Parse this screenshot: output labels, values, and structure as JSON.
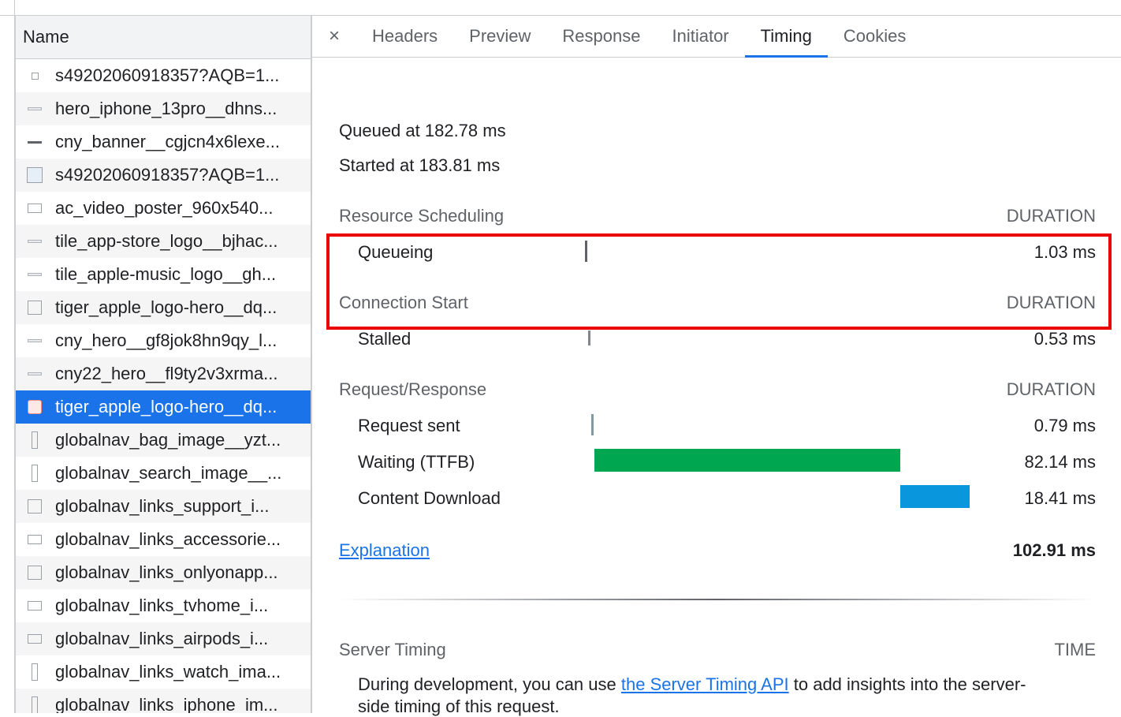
{
  "network_list": {
    "header": "Name",
    "rows": [
      {
        "name": "s49202060918357?AQB=1...",
        "icon": "small-square-icon"
      },
      {
        "name": "hero_iphone_13pro__dhns...",
        "icon": "dash-icon"
      },
      {
        "name": "cny_banner__cgjcn4x6lexe...",
        "icon": "dark-dash-icon"
      },
      {
        "name": "s49202060918357?AQB=1...",
        "icon": "image-icon"
      },
      {
        "name": "ac_video_poster_960x540...",
        "icon": "rect-icon"
      },
      {
        "name": "tile_app-store_logo__bjhac...",
        "icon": "dash-icon"
      },
      {
        "name": "tile_apple-music_logo__gh...",
        "icon": "dash-icon"
      },
      {
        "name": "tiger_apple_logo-hero__dq...",
        "icon": "square-icon"
      },
      {
        "name": "cny_hero__gf8jok8hn9qy_l...",
        "icon": "dash-icon"
      },
      {
        "name": "cny22_hero__fl9ty2v3xrma...",
        "icon": "dash-icon"
      },
      {
        "name": "tiger_apple_logo-hero__dq...",
        "icon": "apple-image-icon",
        "selected": true
      },
      {
        "name": "globalnav_bag_image__yzt...",
        "icon": "tall-rect-icon"
      },
      {
        "name": "globalnav_search_image__...",
        "icon": "tall-rect-icon"
      },
      {
        "name": "globalnav_links_support_i...",
        "icon": "square-icon"
      },
      {
        "name": "globalnav_links_accessorie...",
        "icon": "rect-icon"
      },
      {
        "name": "globalnav_links_onlyonapp...",
        "icon": "square-icon"
      },
      {
        "name": "globalnav_links_tvhome_i...",
        "icon": "rect-icon"
      },
      {
        "name": "globalnav_links_airpods_i...",
        "icon": "rect-icon"
      },
      {
        "name": "globalnav_links_watch_ima...",
        "icon": "tall-rect-icon"
      },
      {
        "name": "globalnav_links_iphone_im...",
        "icon": "tall-rect-icon"
      }
    ]
  },
  "tabs": {
    "close_glyph": "×",
    "items": [
      "Headers",
      "Preview",
      "Response",
      "Initiator",
      "Timing",
      "Cookies"
    ],
    "active": "Timing"
  },
  "timing": {
    "queued_at": "Queued at 182.78 ms",
    "started_at": "Started at 183.81 ms",
    "sections": [
      {
        "title": "Resource Scheduling",
        "duration_label": "DURATION",
        "rows": [
          {
            "label": "Queueing",
            "value": "1.03 ms",
            "bar_color": "#5f6368",
            "bar_start_frac": 0.0,
            "bar_width_frac": 0.0
          }
        ]
      },
      {
        "title": "Connection Start",
        "duration_label": "DURATION",
        "highlighted": true,
        "rows": [
          {
            "label": "Stalled",
            "value": "0.53 ms",
            "bar_color": "#80868b"
          }
        ]
      },
      {
        "title": "Request/Response",
        "duration_label": "DURATION",
        "rows": [
          {
            "label": "Request sent",
            "value": "0.79 ms",
            "bar_color": "#7a9ba0"
          },
          {
            "label": "Waiting (TTFB)",
            "value": "82.14 ms",
            "bar_color": "#00a650"
          },
          {
            "label": "Content Download",
            "value": "18.41 ms",
            "bar_color": "#0a96dc"
          }
        ]
      }
    ],
    "explanation_link": "Explanation",
    "total": "102.91 ms",
    "server_timing": {
      "title": "Server Timing",
      "time_label": "TIME",
      "text_before": "During development, you can use ",
      "link": "the Server Timing API",
      "text_after_line1": " to add insights into the server-",
      "text_line2": "side timing of this request."
    }
  }
}
